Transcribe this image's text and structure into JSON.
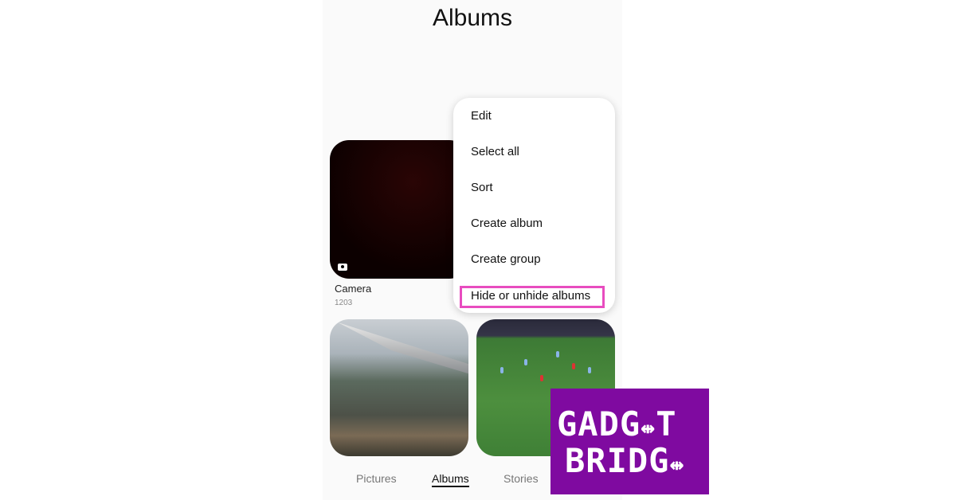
{
  "header": {
    "title": "Albums"
  },
  "albums": [
    {
      "name": "Camera",
      "count": "1203"
    }
  ],
  "menu": {
    "items": [
      "Edit",
      "Select all",
      "Sort",
      "Create album",
      "Create group",
      "Hide or unhide albums"
    ],
    "highlight_color": "#e84cbf"
  },
  "tabs": [
    "Pictures",
    "Albums",
    "Stories"
  ],
  "active_tab": "Albums",
  "watermark": {
    "line1": "GADGET",
    "line2": "BRIDGE",
    "color": "#7f0aa0"
  }
}
